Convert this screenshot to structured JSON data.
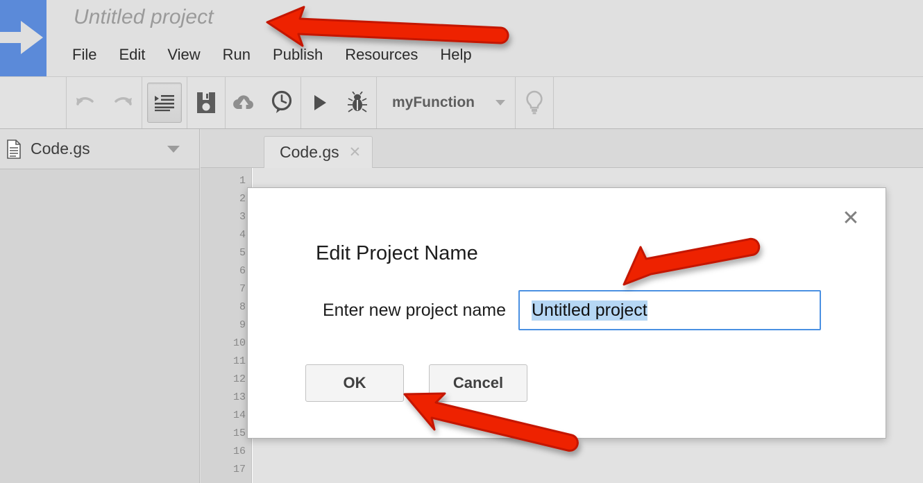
{
  "app": {
    "project_title": "Untitled project",
    "logo_icon": "right-arrow-logo"
  },
  "menubar": {
    "items": [
      {
        "label": "File"
      },
      {
        "label": "Edit"
      },
      {
        "label": "View"
      },
      {
        "label": "Run"
      },
      {
        "label": "Publish"
      },
      {
        "label": "Resources"
      },
      {
        "label": "Help"
      }
    ]
  },
  "toolbar": {
    "undo_icon": "undo-icon",
    "redo_icon": "redo-icon",
    "indent_icon": "indent-format-icon",
    "save_icon": "save-floppy-icon",
    "deploy_icon": "cloud-upload-icon",
    "history_icon": "clock-history-icon",
    "run_icon": "run-play-icon",
    "debug_icon": "debug-bug-icon",
    "function_name": "myFunction",
    "function_caret_icon": "chevron-down-icon",
    "hint_icon": "lightbulb-icon"
  },
  "sidebar": {
    "file": {
      "name": "Code.gs",
      "icon": "file-document-icon",
      "caret_icon": "chevron-down-icon"
    }
  },
  "editor": {
    "tab": {
      "label": "Code.gs",
      "close_icon": "close-icon"
    },
    "gutter_lines": [
      "1",
      "2",
      "3",
      "4",
      "5",
      "6",
      "7",
      "8",
      "9",
      "10",
      "11",
      "12",
      "13",
      "14",
      "15",
      "16",
      "17"
    ]
  },
  "dialog": {
    "title": "Edit Project Name",
    "close_icon": "close-icon",
    "field": {
      "label": "Enter new project name",
      "value": "Untitled project",
      "selected": true
    },
    "buttons": [
      {
        "label": "OK",
        "name": "ok-button"
      },
      {
        "label": "Cancel",
        "name": "cancel-button"
      }
    ]
  },
  "annotations": {
    "color": "#ee2200",
    "outline": "#cc1100",
    "arrows": [
      {
        "name": "arrow-to-project-title",
        "target": "project-title"
      },
      {
        "name": "arrow-to-name-input",
        "target": "project-name-input"
      },
      {
        "name": "arrow-to-ok-button",
        "target": "ok-button"
      }
    ]
  },
  "colors": {
    "logo_blue": "#5b8ad9",
    "chrome_gray": "#e0e0e0",
    "sidebar_gray": "#d4d4d4",
    "input_border_blue": "#4a90e2",
    "selection_blue": "#b6d7f4",
    "annotation_red": "#ee2200"
  }
}
